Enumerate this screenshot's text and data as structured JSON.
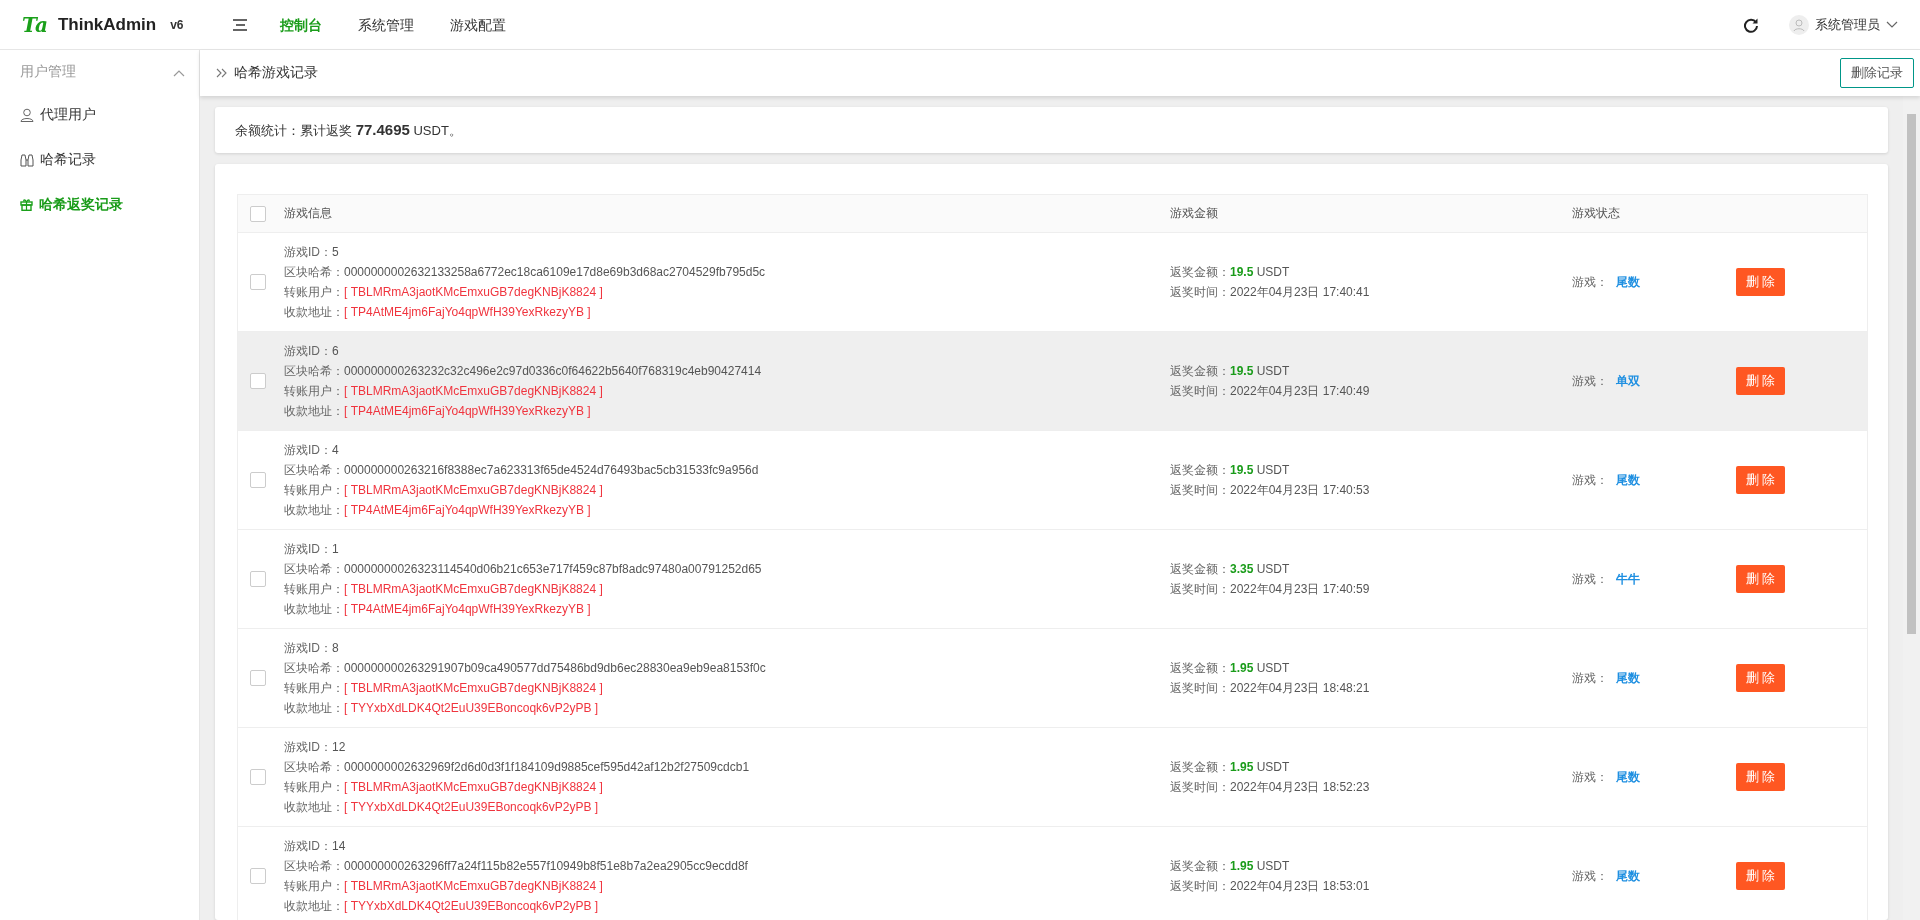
{
  "header": {
    "logo_mark": "Ta",
    "title": "ThinkAdmin",
    "version": "v6",
    "nav": [
      {
        "label": "控制台",
        "selected": true
      },
      {
        "label": "系统管理",
        "selected": false
      },
      {
        "label": "游戏配置",
        "selected": false
      }
    ],
    "user": "系统管理员"
  },
  "sidebar": {
    "group": {
      "label": "用户管理",
      "expanded": true
    },
    "items": [
      {
        "label": "代理用户",
        "selected": false
      },
      {
        "label": "哈希记录",
        "selected": false
      },
      {
        "label": "哈希返奖记录",
        "selected": true
      }
    ]
  },
  "breadcrumb": {
    "title": "哈希游戏记录",
    "action": "删除记录"
  },
  "summary": "余额统计：累计返奖 **77.4695** USDT。",
  "table": {
    "header_checked": false,
    "columns": [
      "游戏信息",
      "游戏金额",
      "游戏状态"
    ],
    "rows": [
      {
        "checked": false,
        "hovered": false,
        "info": [
          {
            "label": "游戏ID：",
            "value": "5",
            "kind": "plain"
          },
          {
            "label": "区块哈希：",
            "value": "0000000002632133258a6772ec18ca6109e17d8e69b3d68ac2704529fb795d5c",
            "kind": "plain"
          },
          {
            "label": "转账用户：",
            "value": "[ TBLMRmA3jaotKMcEmxuGB7degKNBjK8824 ]",
            "kind": "address"
          },
          {
            "label": "收款地址：",
            "value": "[ TP4AtME4jm6FajYo4qpWfH39YexRkezyYB ]",
            "kind": "address"
          }
        ],
        "amount": {
          "label": "返奖金额：",
          "value": "19.5",
          "unit": "USDT"
        },
        "time": {
          "label": "返奖时间：",
          "value": "2022年04月23日 17:40:41"
        },
        "game": {
          "label": "游戏：",
          "value": "尾数"
        },
        "button": "删 除"
      },
      {
        "checked": false,
        "hovered": true,
        "info": [
          {
            "label": "游戏ID：",
            "value": "6",
            "kind": "plain"
          },
          {
            "label": "区块哈希：",
            "value": "000000000263232c32c496e2c97d0336c0f64622b5640f768319c4eb90427414",
            "kind": "plain"
          },
          {
            "label": "转账用户：",
            "value": "[ TBLMRmA3jaotKMcEmxuGB7degKNBjK8824 ]",
            "kind": "address"
          },
          {
            "label": "收款地址：",
            "value": "[ TP4AtME4jm6FajYo4qpWfH39YexRkezyYB ]",
            "kind": "address"
          }
        ],
        "amount": {
          "label": "返奖金额：",
          "value": "19.5",
          "unit": "USDT"
        },
        "time": {
          "label": "返奖时间：",
          "value": "2022年04月23日 17:40:49"
        },
        "game": {
          "label": "游戏：",
          "value": "单双"
        },
        "button": "删 除"
      },
      {
        "checked": false,
        "hovered": false,
        "info": [
          {
            "label": "游戏ID：",
            "value": "4",
            "kind": "plain"
          },
          {
            "label": "区块哈希：",
            "value": "000000000263216f8388ec7a623313f65de4524d76493bac5cb31533fc9a956d",
            "kind": "plain"
          },
          {
            "label": "转账用户：",
            "value": "[ TBLMRmA3jaotKMcEmxuGB7degKNBjK8824 ]",
            "kind": "address"
          },
          {
            "label": "收款地址：",
            "value": "[ TP4AtME4jm6FajYo4qpWfH39YexRkezyYB ]",
            "kind": "address"
          }
        ],
        "amount": {
          "label": "返奖金额：",
          "value": "19.5",
          "unit": "USDT"
        },
        "time": {
          "label": "返奖时间：",
          "value": "2022年04月23日 17:40:53"
        },
        "game": {
          "label": "游戏：",
          "value": "尾数"
        },
        "button": "删 除"
      },
      {
        "checked": false,
        "hovered": false,
        "info": [
          {
            "label": "游戏ID：",
            "value": "1",
            "kind": "plain"
          },
          {
            "label": "区块哈希：",
            "value": "00000000026323114540d06b21c653e717f459c87bf8adc97480a00791252d65",
            "kind": "plain"
          },
          {
            "label": "转账用户：",
            "value": "[ TBLMRmA3jaotKMcEmxuGB7degKNBjK8824 ]",
            "kind": "address"
          },
          {
            "label": "收款地址：",
            "value": "[ TP4AtME4jm6FajYo4qpWfH39YexRkezyYB ]",
            "kind": "address"
          }
        ],
        "amount": {
          "label": "返奖金额：",
          "value": "3.35",
          "unit": "USDT"
        },
        "time": {
          "label": "返奖时间：",
          "value": "2022年04月23日 17:40:59"
        },
        "game": {
          "label": "游戏：",
          "value": "牛牛"
        },
        "button": "删 除"
      },
      {
        "checked": false,
        "hovered": false,
        "info": [
          {
            "label": "游戏ID：",
            "value": "8",
            "kind": "plain"
          },
          {
            "label": "区块哈希：",
            "value": "000000000263291907b09ca490577dd75486bd9db6ec28830ea9eb9ea8153f0c",
            "kind": "plain"
          },
          {
            "label": "转账用户：",
            "value": "[ TBLMRmA3jaotKMcEmxuGB7degKNBjK8824 ]",
            "kind": "address"
          },
          {
            "label": "收款地址：",
            "value": "[ TYYxbXdLDK4Qt2EuU39EBoncoqk6vP2yPB ]",
            "kind": "address"
          }
        ],
        "amount": {
          "label": "返奖金额：",
          "value": "1.95",
          "unit": "USDT"
        },
        "time": {
          "label": "返奖时间：",
          "value": "2022年04月23日 18:48:21"
        },
        "game": {
          "label": "游戏：",
          "value": "尾数"
        },
        "button": "删 除"
      },
      {
        "checked": false,
        "hovered": false,
        "info": [
          {
            "label": "游戏ID：",
            "value": "12",
            "kind": "plain"
          },
          {
            "label": "区块哈希：",
            "value": "0000000002632969f2d6d0d3f1f184109d9885cef595d42af12b2f27509cdcb1",
            "kind": "plain"
          },
          {
            "label": "转账用户：",
            "value": "[ TBLMRmA3jaotKMcEmxuGB7degKNBjK8824 ]",
            "kind": "address"
          },
          {
            "label": "收款地址：",
            "value": "[ TYYxbXdLDK4Qt2EuU39EBoncoqk6vP2yPB ]",
            "kind": "address"
          }
        ],
        "amount": {
          "label": "返奖金额：",
          "value": "1.95",
          "unit": "USDT"
        },
        "time": {
          "label": "返奖时间：",
          "value": "2022年04月23日 18:52:23"
        },
        "game": {
          "label": "游戏：",
          "value": "尾数"
        },
        "button": "删 除"
      },
      {
        "checked": false,
        "hovered": false,
        "info": [
          {
            "label": "游戏ID：",
            "value": "14",
            "kind": "plain"
          },
          {
            "label": "区块哈希：",
            "value": "000000000263296ff7a24f115b82e557f10949b8f51e8b7a2ea2905cc9ecdd8f",
            "kind": "plain"
          },
          {
            "label": "转账用户：",
            "value": "[ TBLMRmA3jaotKMcEmxuGB7degKNBjK8824 ]",
            "kind": "address"
          },
          {
            "label": "收款地址：",
            "value": "[ TYYxbXdLDK4Qt2EuU39EBoncoqk6vP2yPB ]",
            "kind": "address"
          }
        ],
        "amount": {
          "label": "返奖金额：",
          "value": "1.95",
          "unit": "USDT"
        },
        "time": {
          "label": "返奖时间：",
          "value": "2022年04月23日 18:53:01"
        },
        "game": {
          "label": "游戏：",
          "value": "尾数"
        },
        "button": "删 除"
      }
    ]
  }
}
